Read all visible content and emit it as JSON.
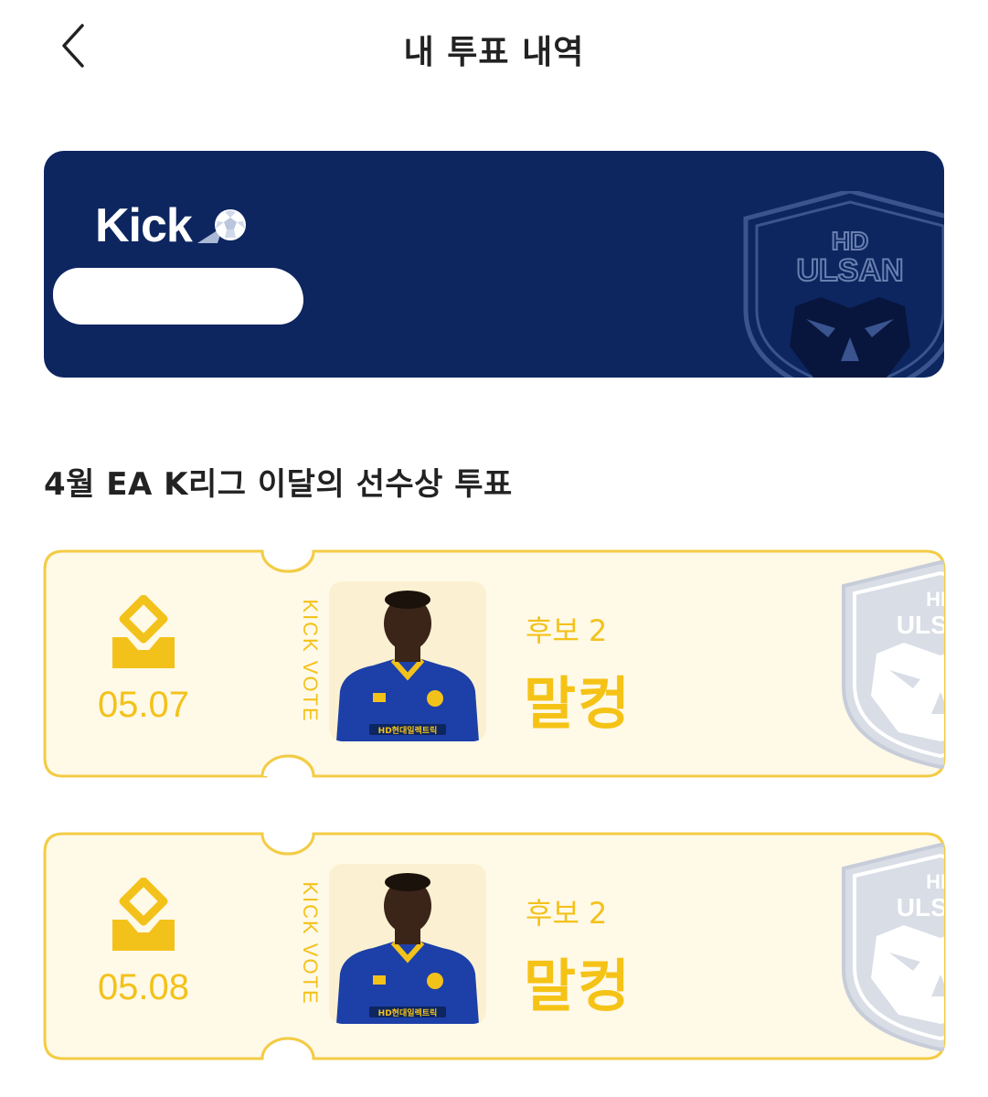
{
  "header": {
    "title": "내 투표 내역"
  },
  "banner": {
    "brand": "Kick",
    "emblem_top": "HD",
    "emblem_name": "ULSAN",
    "background_color": "#0d2660"
  },
  "section": {
    "title": "4월 EA K리그 이달의 선수상 투표"
  },
  "tickets": [
    {
      "date": "05.07",
      "side_label": "KICK VOTE",
      "candidate_label": "후보 2",
      "candidate_name": "말컹",
      "emblem_top": "HD",
      "emblem_name": "ULSAN"
    },
    {
      "date": "05.08",
      "side_label": "KICK VOTE",
      "candidate_label": "후보 2",
      "candidate_name": "말컹",
      "emblem_top": "HD",
      "emblem_name": "ULSAN"
    }
  ],
  "colors": {
    "accent": "#f3c21a",
    "ticket_bg": "#fffaeb",
    "ticket_border": "#f3cc45",
    "jersey": "#1d3fa8"
  },
  "icons": [
    "chevron-left-icon",
    "soccer-ball-icon",
    "ballot-box-icon",
    "ulsan-emblem-icon"
  ]
}
